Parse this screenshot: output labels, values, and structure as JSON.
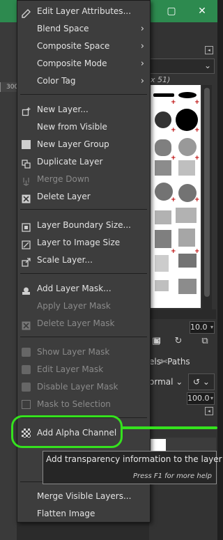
{
  "menu": {
    "items": [
      {
        "label": "Edit Layer Attributes...",
        "icon": "edit-attributes-icon"
      },
      {
        "label": "Blend Space",
        "submenu": true
      },
      {
        "label": "Composite Space",
        "submenu": true
      },
      {
        "label": "Composite Mode",
        "submenu": true
      },
      {
        "label": "Color Tag",
        "submenu": true
      },
      {
        "label": "New Layer...",
        "icon": "new-layer-icon"
      },
      {
        "label": "New from Visible"
      },
      {
        "label": "New Layer Group",
        "icon": "new-layer-group-icon"
      },
      {
        "label": "Duplicate Layer",
        "icon": "duplicate-layer-icon"
      },
      {
        "label": "Merge Down",
        "icon": "merge-down-icon",
        "disabled": true
      },
      {
        "label": "Delete Layer",
        "icon": "delete-layer-icon"
      },
      {
        "label": "Layer Boundary Size...",
        "icon": "layer-boundary-icon"
      },
      {
        "label": "Layer to Image Size",
        "icon": "layer-to-image-icon"
      },
      {
        "label": "Scale Layer...",
        "icon": "scale-layer-icon"
      },
      {
        "label": "Add Layer Mask...",
        "icon": "add-mask-icon"
      },
      {
        "label": "Apply Layer Mask",
        "disabled": true
      },
      {
        "label": "Delete Layer Mask",
        "icon": "delete-mask-icon",
        "disabled": true
      },
      {
        "label": "Show Layer Mask",
        "disabled": true
      },
      {
        "label": "Edit Layer Mask",
        "disabled": true
      },
      {
        "label": "Disable Layer Mask",
        "disabled": true
      },
      {
        "label": "Mask to Selection",
        "icon": "mask-to-selection-icon",
        "disabled": true
      },
      {
        "label": "Add Alpha Channel",
        "icon": "alpha-channel-icon"
      },
      {
        "label": "Merge Visible Layers..."
      },
      {
        "label": "Flatten Image"
      }
    ]
  },
  "tooltip": {
    "text": "Add transparency information to the layer",
    "hint": "Press F1 for more help"
  },
  "background": {
    "ruler_label": "300",
    "brush_size_label": "x 51)",
    "spacing_value": "10.0",
    "tabs_label1": "els",
    "tabs_label2": "Paths",
    "mode_label": "ormal",
    "opacity_value": "100.0"
  },
  "colors": {
    "titlebar": "#2d8a4f",
    "menu_bg": "#3d3d3d",
    "highlight": "#35e21e"
  }
}
